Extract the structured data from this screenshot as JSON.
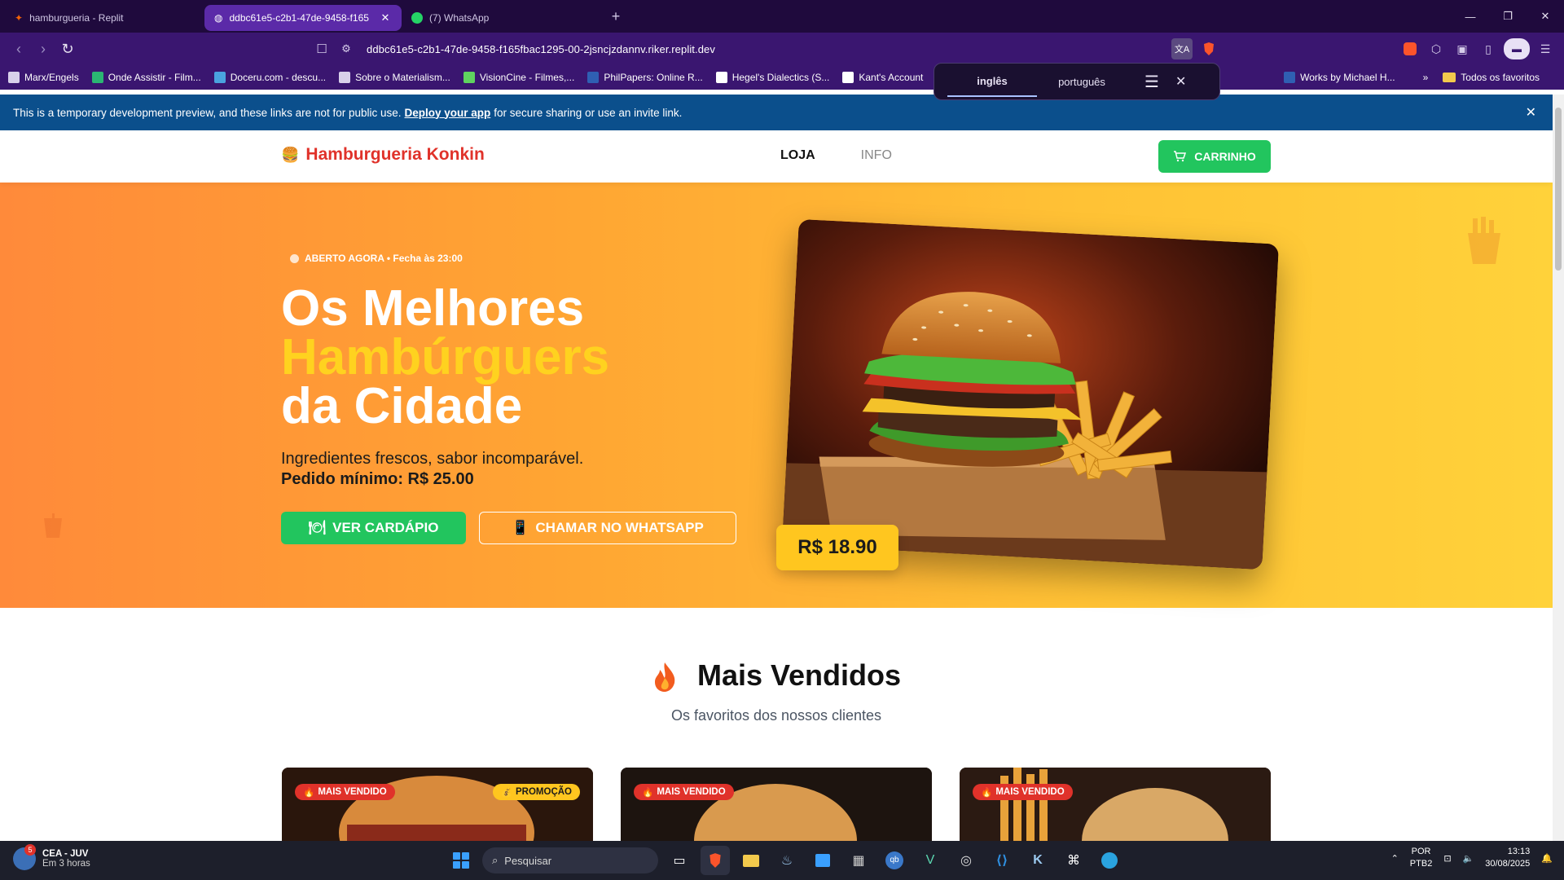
{
  "browser": {
    "tabs": [
      {
        "label": "hamburgueria - Replit"
      },
      {
        "label": "ddbc61e5-c2b1-47de-9458-f165"
      },
      {
        "label": "(7) WhatsApp"
      }
    ],
    "url": "ddbc61e5-c2b1-47de-9458-f165fbac1295-00-2jsncjzdannv.riker.replit.dev",
    "bookmarks": [
      "Marx/Engels",
      "Onde Assistir - Film...",
      "Doceru.com - descu...",
      "Sobre o Materialism...",
      "VisionCine - Filmes,...",
      "PhilPapers: Online R...",
      "Hegel's Dialectics (S...",
      "Kant's Account",
      "Works by Michael H..."
    ],
    "all_bookmarks": "Todos os favoritos",
    "translate": {
      "tab_source": "inglês",
      "tab_target": "português"
    }
  },
  "banner": {
    "text_before": "This is a temporary development preview, and these links are not for public use.",
    "link": "Deploy your app",
    "text_after": "for secure sharing or use an invite link."
  },
  "site": {
    "brand": "Hamburgueria Konkin",
    "nav": {
      "loja": "LOJA",
      "info": "INFO"
    },
    "cart_label": "CARRINHO",
    "hero": {
      "status": "ABERTO AGORA • Fecha às 23:00",
      "title_line1": "Os Melhores",
      "title_line2": "Hambúrguers",
      "title_line3": "da Cidade",
      "subtitle": "Ingredientes frescos, sabor incomparável.",
      "min_order": "Pedido mínimo: R$ 25.00",
      "btn_menu": "VER CARDÁPIO",
      "btn_whatsapp": "CHAMAR NO WHATSAPP",
      "price": "R$ 18.90"
    },
    "section": {
      "title": "Mais Vendidos",
      "subtitle": "Os favoritos dos nossos clientes"
    },
    "cards": [
      {
        "tag": "MAIS VENDIDO",
        "promo": "PROMOÇÃO"
      },
      {
        "tag": "MAIS VENDIDO"
      },
      {
        "tag": "MAIS VENDIDO"
      }
    ]
  },
  "taskbar": {
    "weather_title": "CEA - JUV",
    "weather_sub": "Em 3 horas",
    "weather_badge": "5",
    "search_placeholder": "Pesquisar",
    "lang_line1": "POR",
    "lang_line2": "PTB2",
    "time": "13:13",
    "date": "30/08/2025"
  },
  "colors": {
    "brand_red": "#e0322a",
    "accent_green": "#22c55e",
    "hero_orange": "#ff8a3a",
    "hero_yellow": "#ffd21f",
    "browser_purple": "#3a1670",
    "banner_blue": "#0b4f8c"
  }
}
